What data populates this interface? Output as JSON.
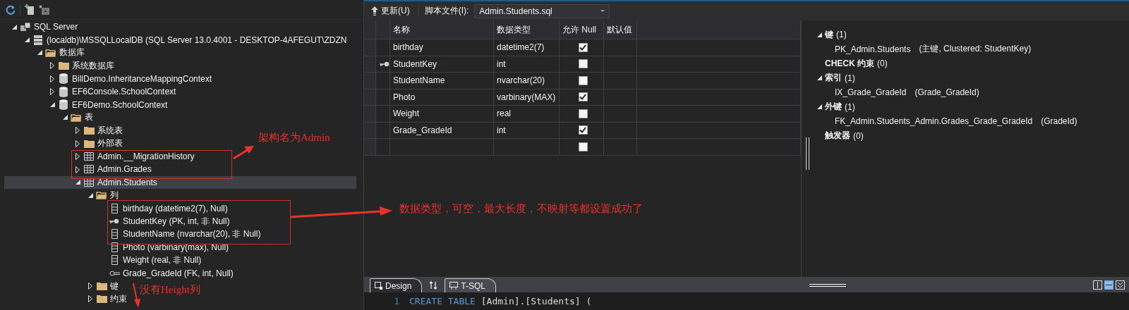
{
  "explorer": {
    "tree": [
      {
        "label": "SQL Server",
        "kind": "server-group",
        "expanded": true,
        "selected": false,
        "children": [
          {
            "label": "(localdb)\\MSSQLLocalDB (SQL Server 13.0.4001 - DESKTOP-4AFEGUT\\ZDZN",
            "kind": "server",
            "expanded": true,
            "selected": false,
            "children": [
              {
                "label": "数据库",
                "kind": "folder-open",
                "expanded": true,
                "selected": false,
                "children": [
                  {
                    "label": "系统数据库",
                    "kind": "folder",
                    "expanded": false,
                    "selected": false
                  },
                  {
                    "label": "BillDemo.InheritanceMappingContext",
                    "kind": "database",
                    "expanded": false,
                    "selected": false
                  },
                  {
                    "label": "EF6Console.SchoolContext",
                    "kind": "database",
                    "expanded": false,
                    "selected": false
                  },
                  {
                    "label": "EF6Demo.SchoolContext",
                    "kind": "database",
                    "expanded": true,
                    "selected": false,
                    "children": [
                      {
                        "label": "表",
                        "kind": "folder-open",
                        "expanded": true,
                        "selected": false,
                        "children": [
                          {
                            "label": "系统表",
                            "kind": "folder",
                            "expanded": false,
                            "selected": false
                          },
                          {
                            "label": "外部表",
                            "kind": "folder",
                            "expanded": false,
                            "selected": false
                          },
                          {
                            "label": "Admin.__MigrationHistory",
                            "kind": "table",
                            "expanded": false,
                            "selected": false
                          },
                          {
                            "label": "Admin.Grades",
                            "kind": "table",
                            "expanded": false,
                            "selected": false
                          },
                          {
                            "label": "Admin.Students",
                            "kind": "table",
                            "expanded": true,
                            "selected": true,
                            "children": [
                              {
                                "label": "列",
                                "kind": "folder-open",
                                "expanded": true,
                                "selected": false,
                                "children": [
                                  {
                                    "label": "birthday (datetime2(7), Null)",
                                    "kind": "column",
                                    "selected": false
                                  },
                                  {
                                    "label": "StudentKey (PK, int, 非 Null)",
                                    "kind": "key",
                                    "selected": false
                                  },
                                  {
                                    "label": "StudentName (nvarchar(20), 非 Null)",
                                    "kind": "column",
                                    "selected": false
                                  },
                                  {
                                    "label": "Photo (varbinary(max), Null)",
                                    "kind": "column",
                                    "selected": false
                                  },
                                  {
                                    "label": "Weight (real, 非 Null)",
                                    "kind": "column",
                                    "selected": false
                                  },
                                  {
                                    "label": "Grade_GradeId (FK, int, Null)",
                                    "kind": "foreign-key",
                                    "selected": false
                                  }
                                ]
                              },
                              {
                                "label": "键",
                                "kind": "folder",
                                "expanded": false,
                                "selected": false
                              },
                              {
                                "label": "约束",
                                "kind": "folder",
                                "expanded": false,
                                "selected": false
                              }
                            ]
                          }
                        ]
                      }
                    ]
                  }
                ]
              }
            ]
          }
        ]
      }
    ]
  },
  "designer": {
    "toolbar": {
      "update_button": "更新(U)",
      "script_label": "脚本文件(I):",
      "script_file": "Admin.Students.sql"
    },
    "columns": [
      "名称",
      "数据类型",
      "允许 Null",
      "默认值"
    ],
    "rows": [
      {
        "name": "birthday",
        "type": "datetime2(7)",
        "allow_null": true,
        "primary_key": false
      },
      {
        "name": "StudentKey",
        "type": "int",
        "allow_null": false,
        "primary_key": true
      },
      {
        "name": "StudentName",
        "type": "nvarchar(20)",
        "allow_null": false,
        "primary_key": false
      },
      {
        "name": "Photo",
        "type": "varbinary(MAX)",
        "allow_null": true,
        "primary_key": false
      },
      {
        "name": "Weight",
        "type": "real",
        "allow_null": false,
        "primary_key": false
      },
      {
        "name": "Grade_GradeId",
        "type": "int",
        "allow_null": true,
        "primary_key": false
      },
      {
        "allow_null": false,
        "primary_key": false
      }
    ],
    "properties": [
      {
        "label": "键",
        "count": "(1)",
        "expanded": true,
        "children": [
          {
            "name": "PK_Admin.Students",
            "detail": "(主键, Clustered: StudentKey)"
          }
        ]
      },
      {
        "label": "CHECK 约束",
        "count": "(0)"
      },
      {
        "label": "索引",
        "count": "(1)",
        "expanded": true,
        "children": [
          {
            "name": "IX_Grade_GradeId",
            "detail": "(Grade_GradeId)"
          }
        ]
      },
      {
        "label": "外键",
        "count": "(1)",
        "expanded": true,
        "children": [
          {
            "name": "FK_Admin.Students_Admin.Grades_Grade_GradeId",
            "detail": "(GradeId)"
          }
        ]
      },
      {
        "label": "触发器",
        "count": "(0)"
      }
    ],
    "tabs": [
      {
        "label": "Design",
        "kind": "design",
        "selected": true
      },
      {
        "label": "T-SQL",
        "kind": "sql",
        "selected": false
      }
    ],
    "code": [
      {
        "line": "1",
        "tokens": [
          {
            "text": "CREATE TABLE",
            "kind": "keyword"
          },
          {
            "text": " [Admin].[Students] (",
            "kind": "plain"
          }
        ]
      }
    ]
  },
  "annotations": [
    {
      "text": "架构名为Admin"
    },
    {
      "text": "数据类型，可空，最大长度，不映射等都设置成功了"
    },
    {
      "text": "没有Height列"
    }
  ]
}
